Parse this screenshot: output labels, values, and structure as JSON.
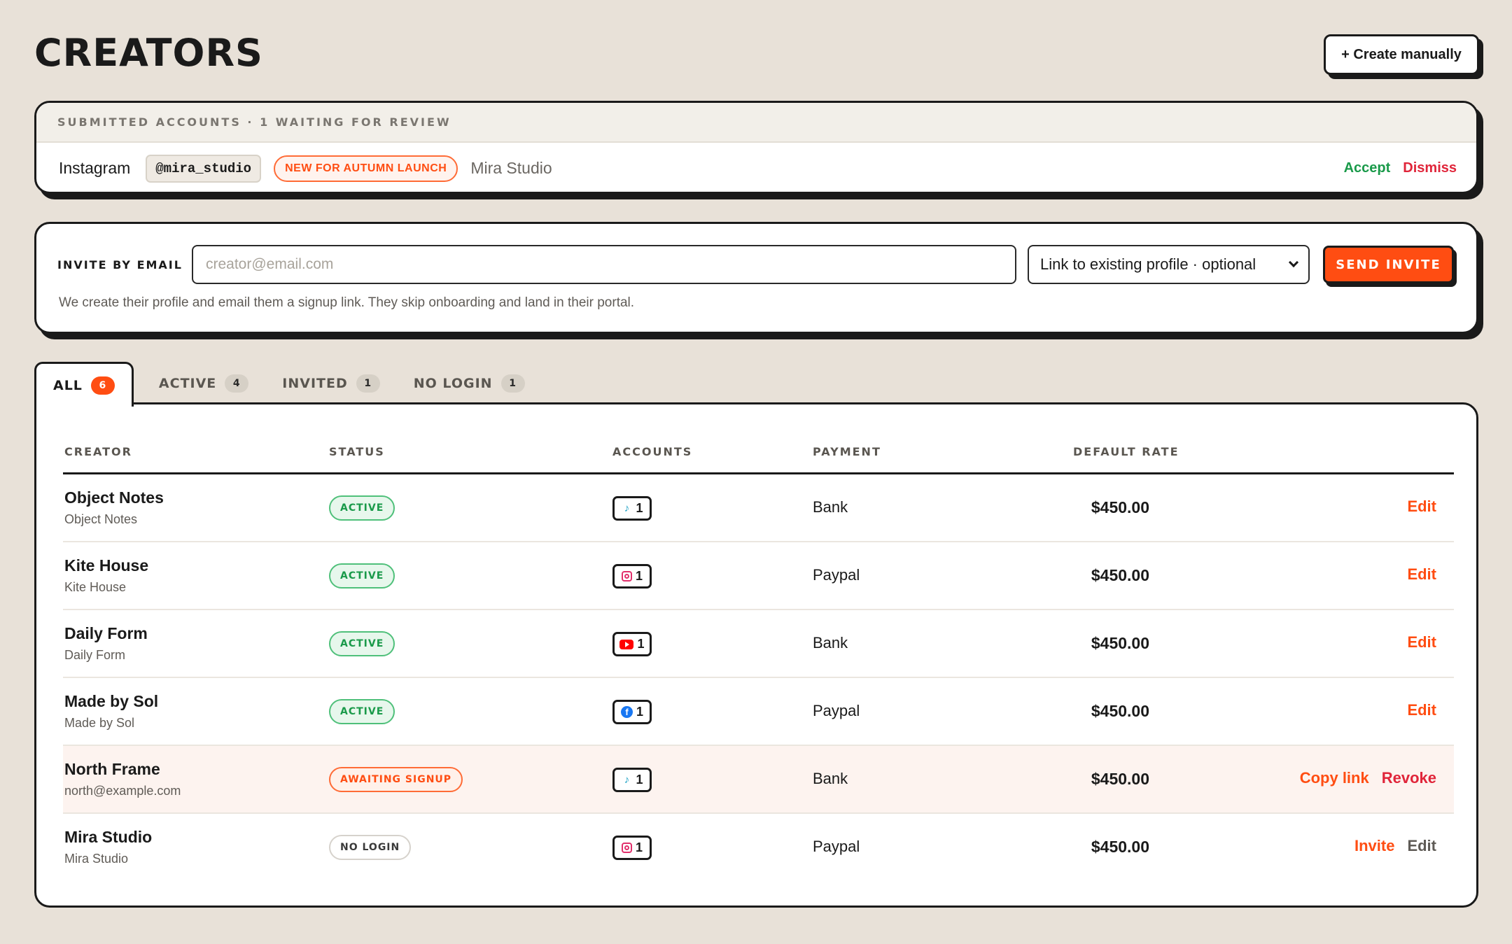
{
  "header": {
    "title": "CREATORS",
    "create_button": "+ Create manually"
  },
  "submitted": {
    "heading": "SUBMITTED ACCOUNTS · 1 WAITING FOR REVIEW",
    "item": {
      "platform": "Instagram",
      "handle": "@mira_studio",
      "campaign": "NEW FOR AUTUMN LAUNCH",
      "name": "Mira Studio",
      "accept": "Accept",
      "dismiss": "Dismiss"
    }
  },
  "invite": {
    "label": "INVITE BY EMAIL",
    "email_placeholder": "creator@email.com",
    "email_value": "",
    "profile_select": "Link to existing profile · optional",
    "send_button": "SEND INVITE",
    "hint": "We create their profile and email them a signup link. They skip onboarding and land in their portal."
  },
  "tabs": [
    {
      "label": "ALL",
      "count": "6",
      "selected": true
    },
    {
      "label": "ACTIVE",
      "count": "4",
      "selected": false
    },
    {
      "label": "INVITED",
      "count": "1",
      "selected": false
    },
    {
      "label": "NO LOGIN",
      "count": "1",
      "selected": false
    }
  ],
  "table": {
    "columns": {
      "creator": "CREATOR",
      "status": "STATUS",
      "accounts": "ACCOUNTS",
      "payment": "PAYMENT",
      "rate": "DEFAULT RATE"
    },
    "rows": [
      {
        "name": "Object Notes",
        "sub": "Object Notes",
        "status": "ACTIVE",
        "platform_icon": "tiktok-icon",
        "accounts": "1",
        "payment": "Bank",
        "rate": "$450.00",
        "actions": [
          "Edit"
        ]
      },
      {
        "name": "Kite House",
        "sub": "Kite House",
        "status": "ACTIVE",
        "platform_icon": "instagram-icon",
        "accounts": "1",
        "payment": "Paypal",
        "rate": "$450.00",
        "actions": [
          "Edit"
        ]
      },
      {
        "name": "Daily Form",
        "sub": "Daily Form",
        "status": "ACTIVE",
        "platform_icon": "youtube-icon",
        "accounts": "1",
        "payment": "Bank",
        "rate": "$450.00",
        "actions": [
          "Edit"
        ]
      },
      {
        "name": "Made by Sol",
        "sub": "Made by Sol",
        "status": "ACTIVE",
        "platform_icon": "facebook-icon",
        "accounts": "1",
        "payment": "Paypal",
        "rate": "$450.00",
        "actions": [
          "Edit"
        ]
      },
      {
        "name": "North Frame",
        "sub": "north@example.com",
        "status": "AWAITING SIGNUP",
        "platform_icon": "tiktok-icon",
        "accounts": "1",
        "payment": "Bank",
        "rate": "$450.00",
        "actions": [
          "Copy link",
          "Revoke"
        ]
      },
      {
        "name": "Mira Studio",
        "sub": "Mira Studio",
        "status": "NO LOGIN",
        "platform_icon": "instagram-icon",
        "accounts": "1",
        "payment": "Paypal",
        "rate": "$450.00",
        "actions": [
          "Invite",
          "Edit"
        ]
      }
    ]
  },
  "colors": {
    "background": "#e8e1d8",
    "accent": "#ff4d12",
    "success": "#1a9a4a",
    "danger": "#e0253a",
    "ink": "#1a1a1a"
  }
}
